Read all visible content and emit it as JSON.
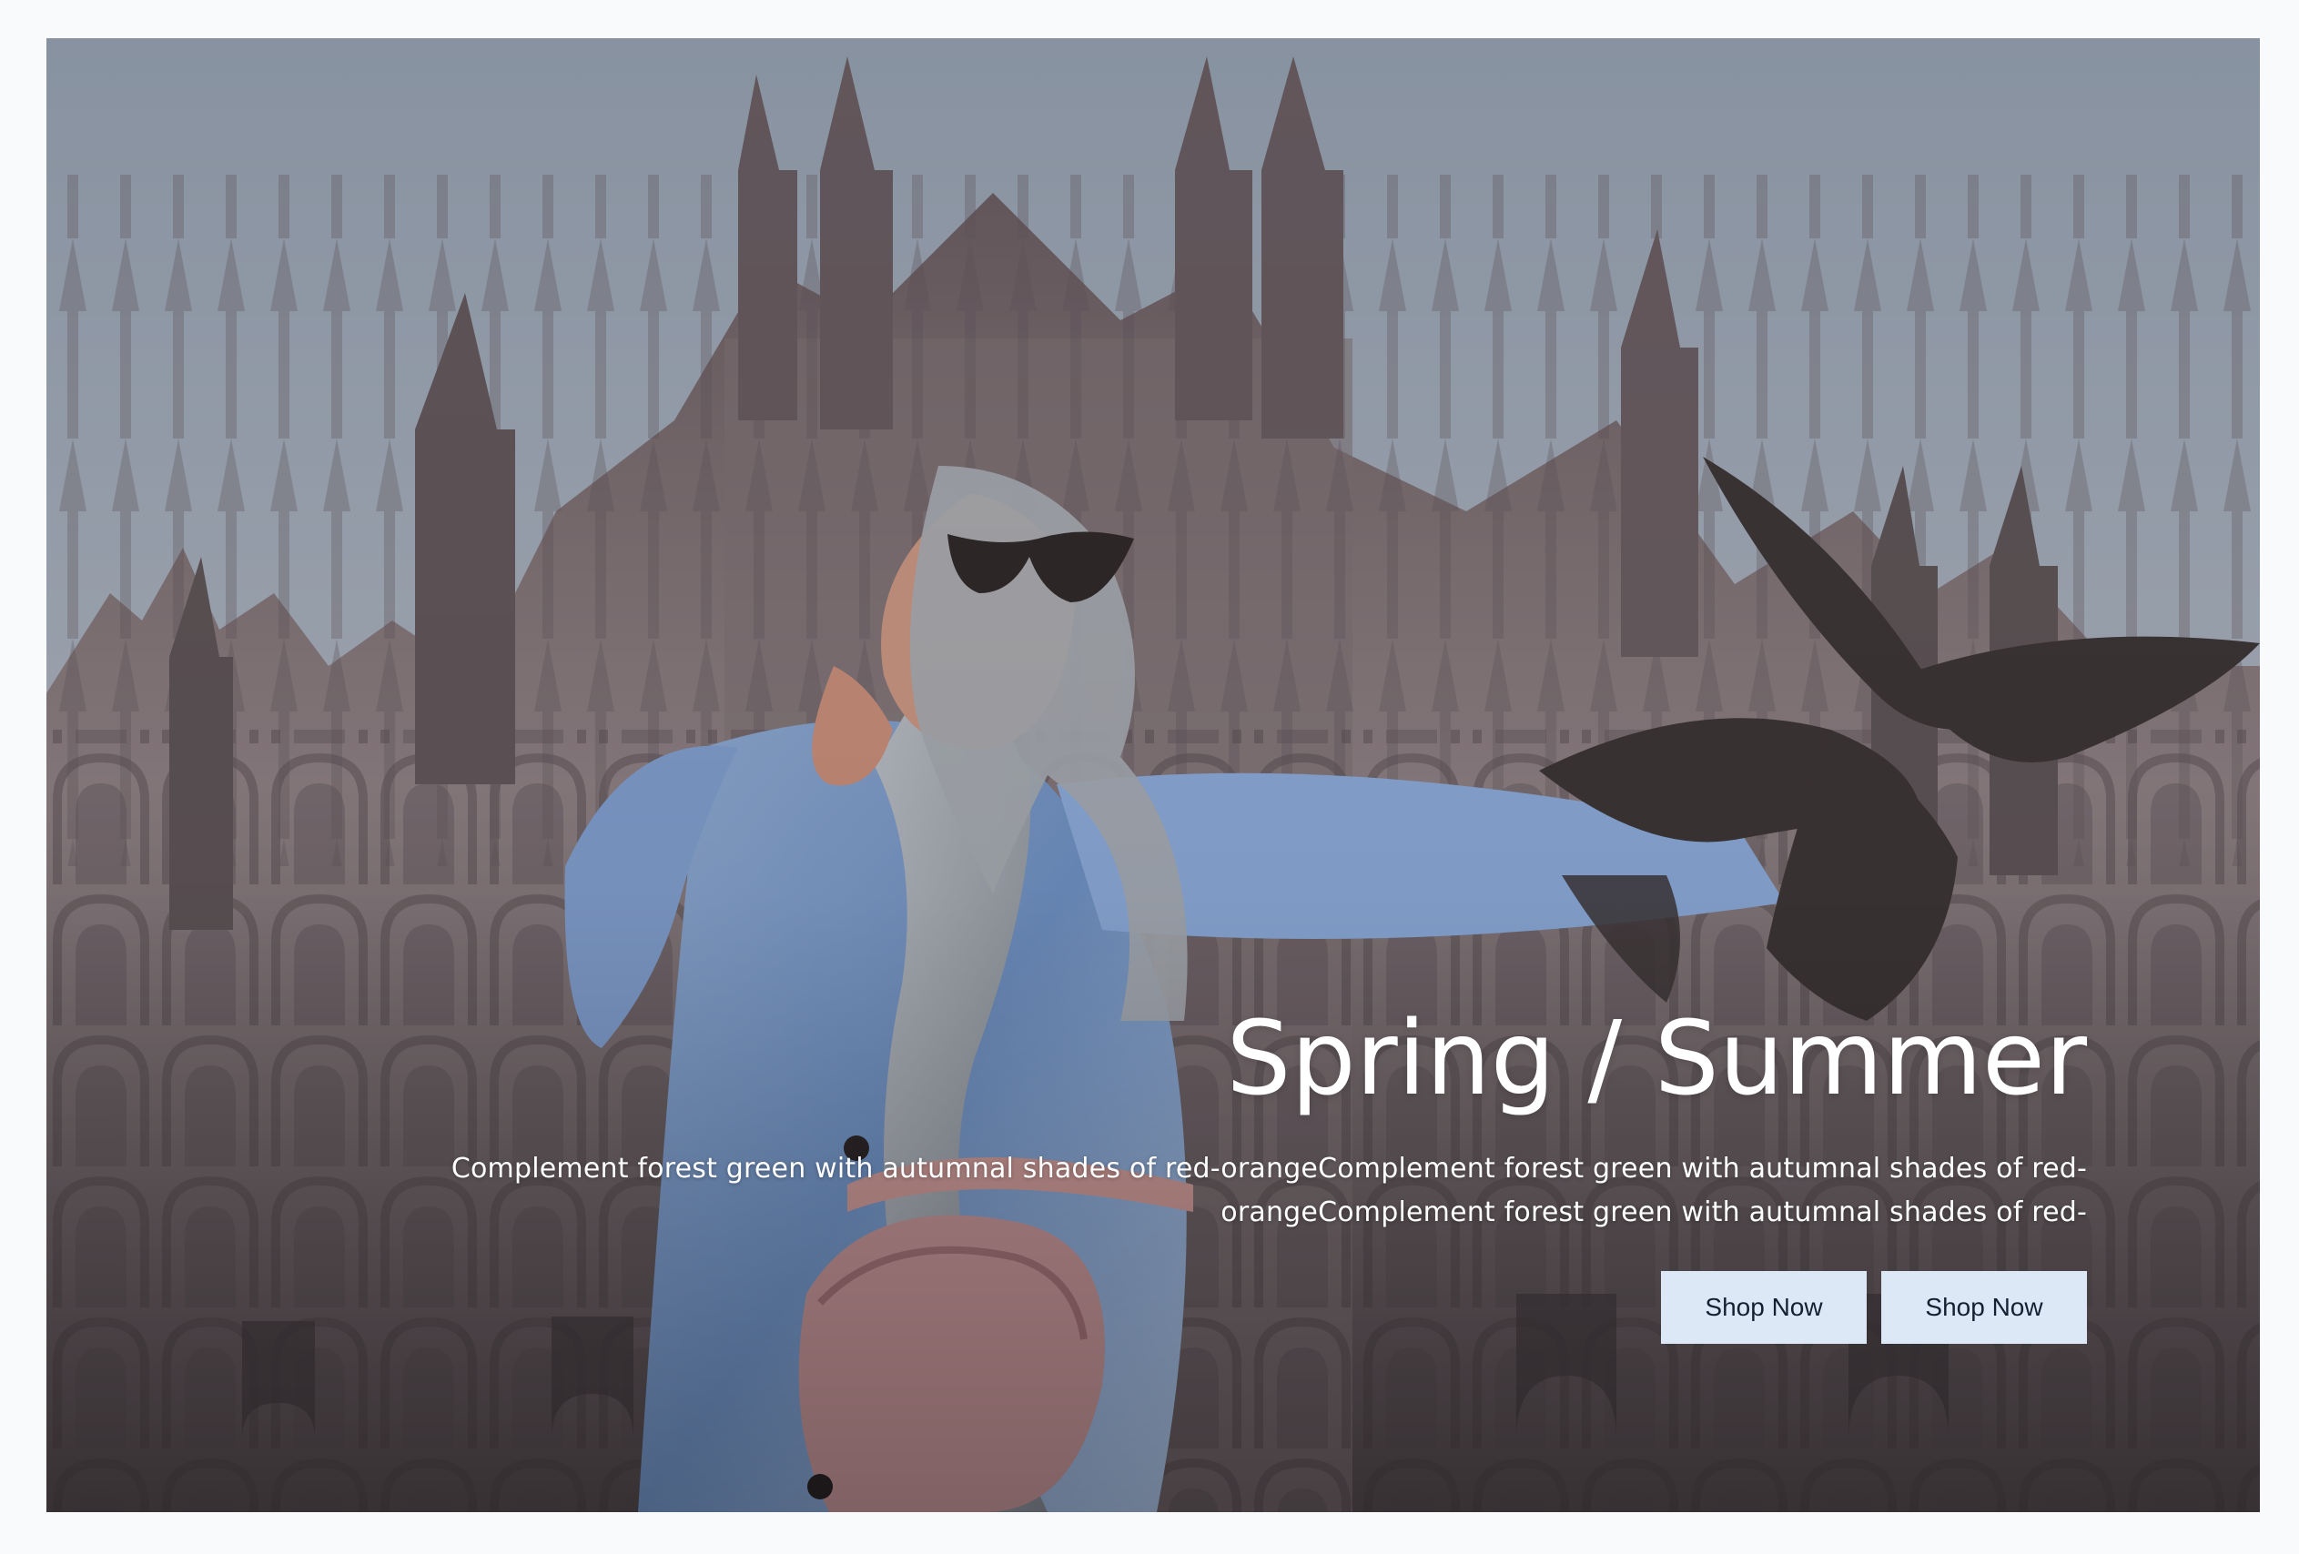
{
  "hero": {
    "title": "Spring / Summer",
    "description_line_1": "Complement forest green with autumnal shades of red-orangeComplement forest green with autumnal shades of red-",
    "description_line_2": "orangeComplement forest green with autumnal shades of red-",
    "buttons": [
      {
        "label": "Shop Now"
      },
      {
        "label": "Shop Now"
      }
    ],
    "colors": {
      "page_background": "#f9fafc",
      "button_background": "#dce8f5",
      "button_text": "#152033",
      "overlay_text": "#ffffff"
    }
  }
}
